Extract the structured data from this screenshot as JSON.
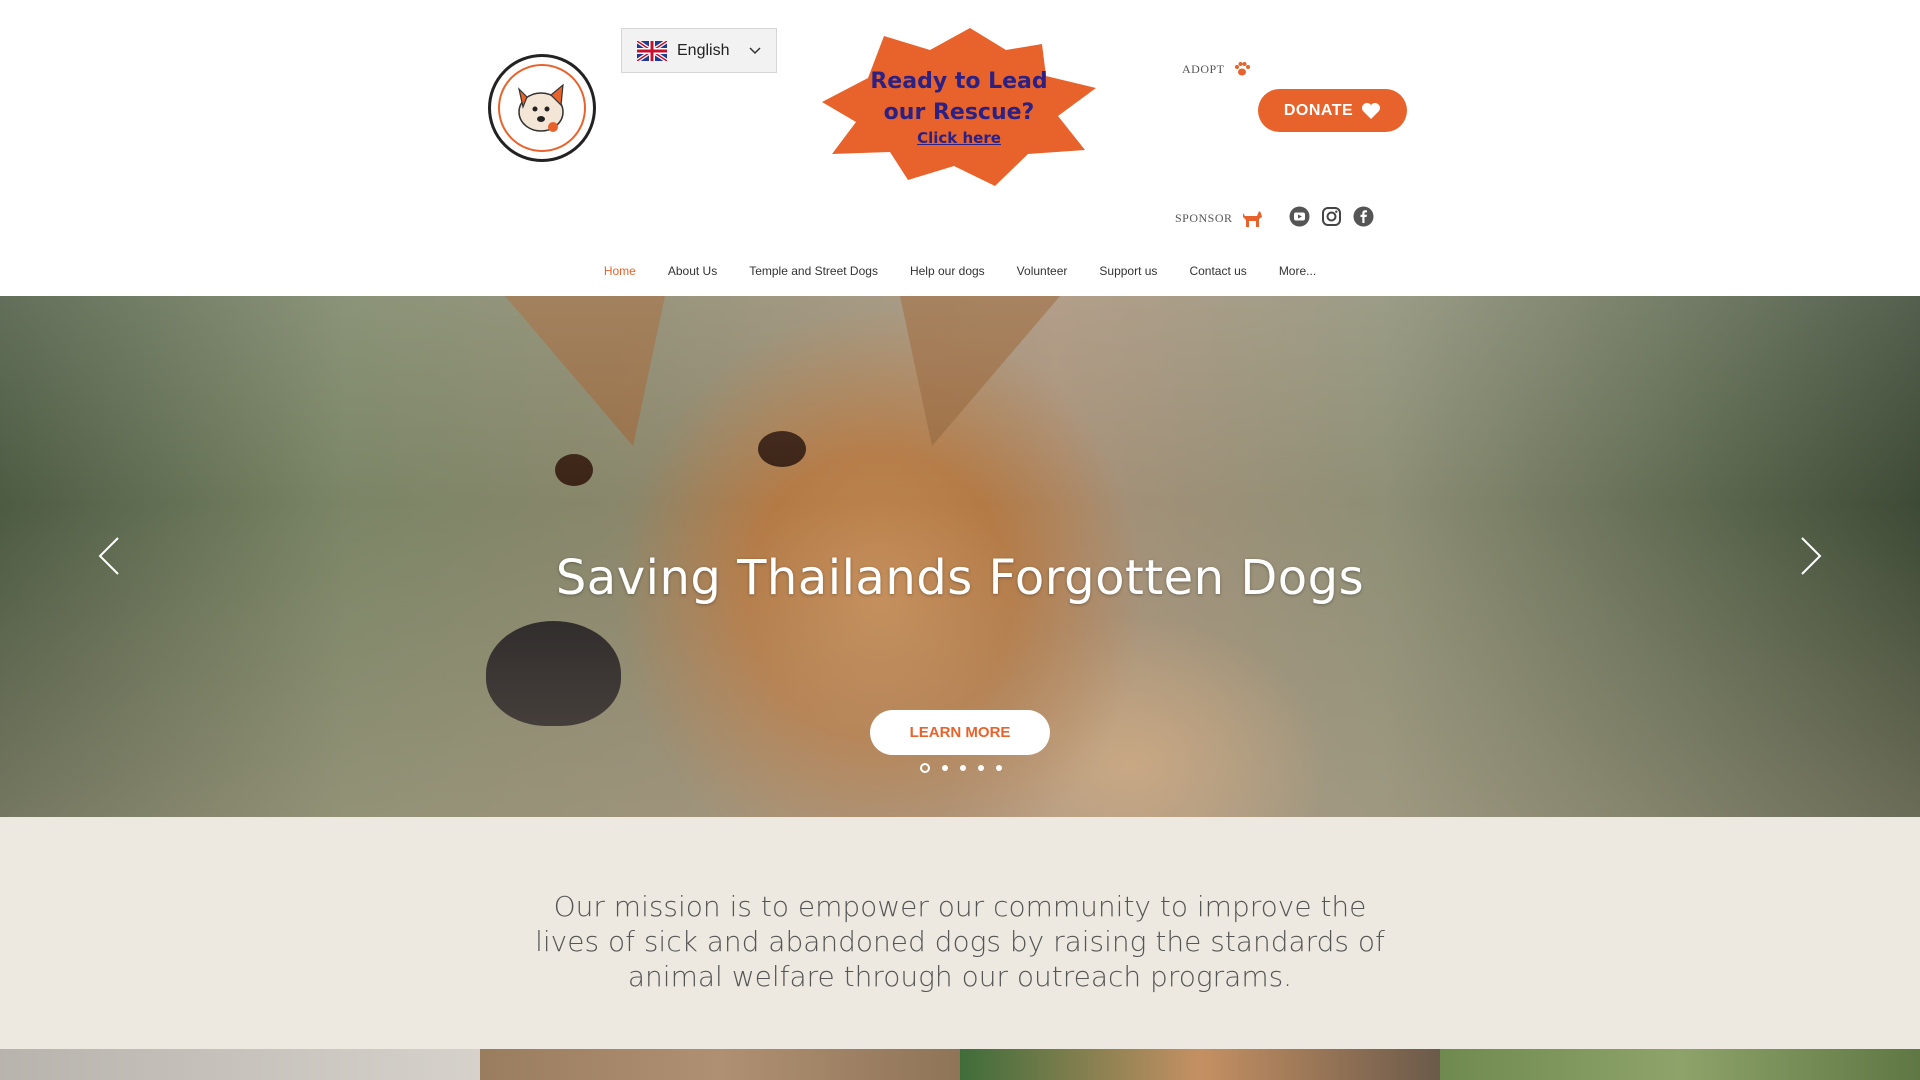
{
  "language": {
    "selected": "English"
  },
  "promo": {
    "line1": "Ready to Lead",
    "line2": "our Rescue?",
    "link": "Click here",
    "color": "#e8632b",
    "text_color": "#2b2185"
  },
  "header": {
    "adopt": "ADOPT",
    "donate": "DONATE",
    "sponsor": "SPONSOR"
  },
  "social": [
    "youtube-icon",
    "instagram-icon",
    "facebook-icon"
  ],
  "nav": {
    "items": [
      "Home",
      "About Us",
      "Temple and Street Dogs",
      "Help our dogs",
      "Volunteer",
      "Support us",
      "Contact us",
      "More..."
    ],
    "active_index": 0
  },
  "hero": {
    "title": "Saving Thailands Forgotten Dogs",
    "button": "LEARN MORE",
    "slide_count": 5,
    "active_slide": 1
  },
  "mission": {
    "text": "Our mission is to empower our community to improve the lives of sick and abandoned dogs by raising the standards of animal welfare through our outreach programs."
  },
  "colors": {
    "accent": "#e8632b",
    "mission_bg": "#ede8e0"
  }
}
